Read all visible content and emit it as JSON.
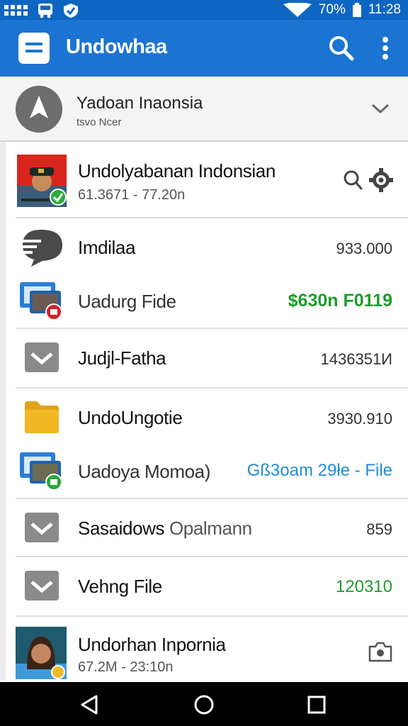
{
  "status_bar": {
    "battery": "70%",
    "time": "11:28",
    "left_icons": [
      "grid-icon",
      "bus-icon",
      "check-shield-icon"
    ]
  },
  "app_bar": {
    "title": "Undowhaa",
    "icons": [
      "menu-icon",
      "search-icon",
      "more-vert-icon"
    ]
  },
  "account": {
    "name": "Yadoan Inaonsia",
    "sub": "tsvo Ncer"
  },
  "rows": [
    {
      "title": "Undolyabanan Indonsian",
      "sub": "61.3671 - 77.20n",
      "icon": "avatar-officer"
    },
    {
      "title": "Imdilaa",
      "value": "933.000",
      "icon": "chat-bubble-icon"
    },
    {
      "title": "Uadurg Fide",
      "value": "$630n F0119",
      "icon": "computer-file-icon"
    },
    {
      "title": "Judjl-Fatha",
      "value": "1436351И",
      "icon": "inbox-icon"
    },
    {
      "title": "UndoUngotie",
      "value": "3930.910",
      "icon": "folder-icon"
    },
    {
      "title": "Uadoya Momoa)",
      "value": "Gß3oam 29łe - File",
      "icon": "computer-file-green-icon"
    },
    {
      "title": "Sasaidows",
      "title_extra": "Opalmann",
      "value": "859",
      "icon": "inbox-icon"
    },
    {
      "title": "Vehng File",
      "value": "120310",
      "icon": "inbox-icon"
    },
    {
      "title": "Undorhan Inpornia",
      "sub": "67.2M - 23:10n",
      "icon": "avatar-woman"
    }
  ],
  "colors": {
    "app_bar": "#1b74d2",
    "status_bar": "#0d66c2",
    "green_value": "#1e9c2c",
    "blue_value": "#1c8fd6",
    "folder": "#f2b824"
  },
  "nav_bar": {
    "icons": [
      "back-icon",
      "home-icon",
      "recents-icon"
    ]
  }
}
